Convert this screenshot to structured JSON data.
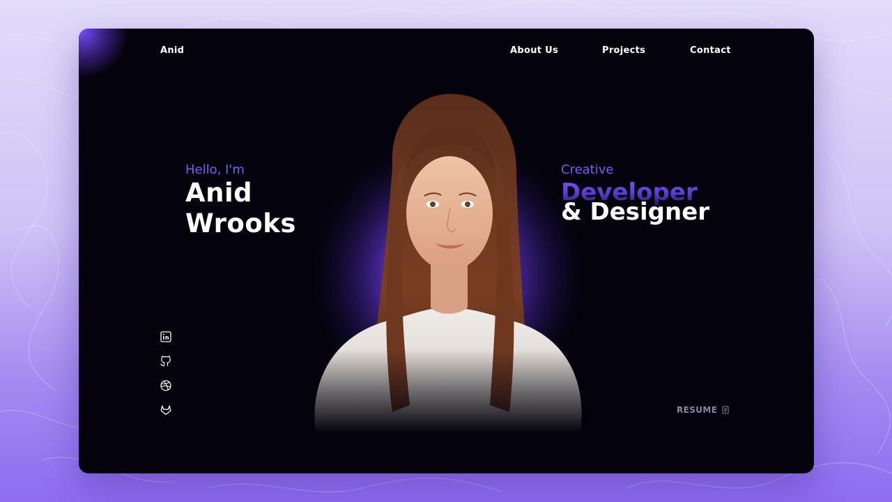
{
  "nav": {
    "logo": "Anid",
    "links": [
      "About Us",
      "Projects",
      "Contact"
    ]
  },
  "hero": {
    "greeting": "Hello, I'm",
    "name_line_1": "Anid",
    "name_line_2": "Wrooks",
    "role_intro": "Creative",
    "role_line_1": "Developer",
    "role_line_2": "& Designer"
  },
  "social": [
    {
      "icon": "linkedin-icon"
    },
    {
      "icon": "github-icon"
    },
    {
      "icon": "dribbble-icon"
    },
    {
      "icon": "gitlab-icon"
    }
  ],
  "resume": {
    "label": "RESUME",
    "icon": "document-icon"
  },
  "colors": {
    "accent": "#7c5cf2",
    "frame_background": "#04030d",
    "text": "#ffffff",
    "muted": "#8a86a8"
  }
}
